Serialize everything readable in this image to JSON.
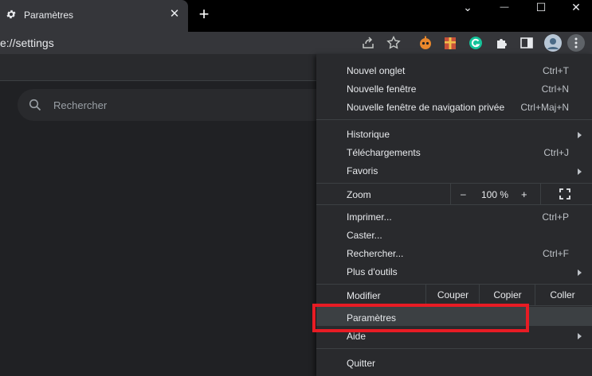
{
  "tab": {
    "title": "Paramètres",
    "close_glyph": "✕",
    "icon": "gear-icon"
  },
  "newtab_glyph": "+",
  "window": {
    "chevron": "⌄",
    "minimize": "—",
    "maximize": "☐",
    "close": "✕"
  },
  "address": {
    "url_visible": "e://settings"
  },
  "search": {
    "placeholder": "Rechercher"
  },
  "menu": {
    "group1": [
      {
        "label": "Nouvel onglet",
        "shortcut": "Ctrl+T"
      },
      {
        "label": "Nouvelle fenêtre",
        "shortcut": "Ctrl+N"
      },
      {
        "label": "Nouvelle fenêtre de navigation privée",
        "shortcut": "Ctrl+Maj+N"
      }
    ],
    "group2": [
      {
        "label": "Historique",
        "shortcut": ""
      },
      {
        "label": "Téléchargements",
        "shortcut": "Ctrl+J"
      },
      {
        "label": "Favoris",
        "shortcut": ""
      }
    ],
    "zoom": {
      "label": "Zoom",
      "minus": "–",
      "value": "100 %",
      "plus": "+"
    },
    "group3": [
      {
        "label": "Imprimer...",
        "shortcut": "Ctrl+P"
      },
      {
        "label": "Caster...",
        "shortcut": ""
      },
      {
        "label": "Rechercher...",
        "shortcut": "Ctrl+F"
      },
      {
        "label": "Plus d'outils",
        "shortcut": ""
      }
    ],
    "edit": {
      "label": "Modifier",
      "cut": "Couper",
      "copy": "Copier",
      "paste": "Coller"
    },
    "settings": "Paramètres",
    "help": "Aide",
    "quit": "Quitter"
  },
  "colors": {
    "highlight_box": "#e81c24",
    "menu_bg": "#292a2d"
  }
}
